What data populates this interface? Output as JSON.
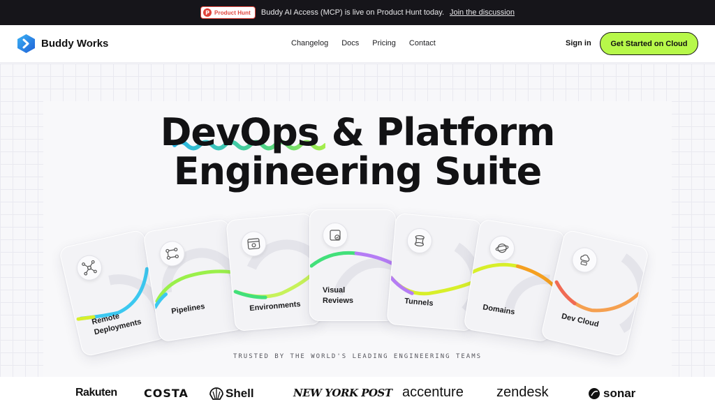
{
  "announcement": {
    "badge": "Product Hunt",
    "badge_letter": "P",
    "text": "Buddy AI Access (MCP) is live on Product Hunt today.",
    "link": "Join the discussion"
  },
  "nav": {
    "brand": "Buddy Works",
    "links": [
      "Changelog",
      "Docs",
      "Pricing",
      "Contact"
    ],
    "sign_in": "Sign in",
    "cta": "Get Started on Cloud"
  },
  "hero": {
    "title_line1": "DevOps & Platform",
    "title_line2": "Engineering Suite",
    "cards": [
      {
        "label1": "Remote",
        "label2": "Deployments",
        "icon": "network-icon",
        "accent": "#3cc8f0"
      },
      {
        "label1": "Pipelines",
        "label2": "",
        "icon": "pipeline-icon",
        "accent": "#9af04a"
      },
      {
        "label1": "Environments",
        "label2": "",
        "icon": "browser-gear-icon",
        "accent": "#42e07a"
      },
      {
        "label1": "Visual",
        "label2": "Reviews",
        "icon": "visual-review-icon",
        "accent": "#b57cf5"
      },
      {
        "label1": "Tunnels",
        "label2": "",
        "icon": "tunnel-icon",
        "accent": "#d8ef2a"
      },
      {
        "label1": "Domains",
        "label2": "",
        "icon": "globe-icon",
        "accent": "#f5a020"
      },
      {
        "label1": "Dev Cloud",
        "label2": "",
        "icon": "cloud-server-icon",
        "accent": "#f06a55"
      }
    ],
    "trusted": "TRUSTED BY THE WORLD'S LEADING ENGINEERING TEAMS"
  },
  "clients": [
    "Rakuten",
    "COSTA",
    "Shell",
    "NEW YORK POST",
    "accenture",
    "zendesk",
    "sonar"
  ],
  "colors": {
    "accent_green": "#b7f84a",
    "dark": "#16151a"
  }
}
